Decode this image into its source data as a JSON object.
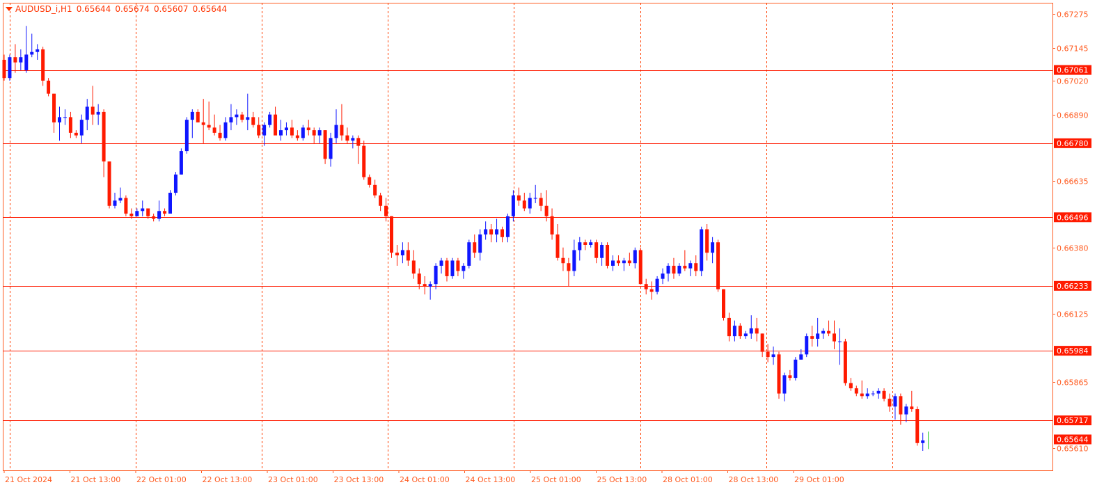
{
  "header": {
    "symbol": "AUDUSD_i,H1",
    "open": "0.65644",
    "high": "0.65674",
    "low": "0.65607",
    "close": "0.65644"
  },
  "colors": {
    "bull": "#0f16ff",
    "bear": "#ff1a00",
    "axis": "#ff5a1f",
    "level_line": "#ff1a00",
    "label_bg": "#ff1a00",
    "grid": "#ff3d00",
    "current": "#22c822"
  },
  "chart_data": {
    "type": "candlestick",
    "timeframe": "H1",
    "y_range": [
      0.6556,
      0.673
    ],
    "y_ticks": [
      "0.67275",
      "0.67145",
      "0.67020",
      "0.66890",
      "0.66635",
      "0.66380",
      "0.66125",
      "0.65865",
      "0.65610"
    ],
    "x_labels": [
      "21 Oct 2024",
      "21 Oct 13:00",
      "22 Oct 01:00",
      "22 Oct 13:00",
      "23 Oct 01:00",
      "23 Oct 13:00",
      "24 Oct 01:00",
      "24 Oct 13:00",
      "25 Oct 01:00",
      "25 Oct 13:00",
      "28 Oct 01:00",
      "28 Oct 13:00",
      "29 Oct 01:00"
    ],
    "day_separators": [
      1,
      25,
      49,
      73,
      97,
      121,
      145,
      169
    ],
    "horizontal_levels": [
      "0.67061",
      "0.66780",
      "0.66496",
      "0.66233",
      "0.65984",
      "0.65717"
    ],
    "current_price": "0.65644",
    "candles": [
      [
        0.671,
        0.6712,
        0.6702,
        0.6703
      ],
      [
        0.6703,
        0.6712,
        0.6702,
        0.6711
      ],
      [
        0.6711,
        0.6716,
        0.6705,
        0.6709
      ],
      [
        0.6709,
        0.6714,
        0.6706,
        0.6711
      ],
      [
        0.6706,
        0.6723,
        0.6705,
        0.6712
      ],
      [
        0.6712,
        0.672,
        0.6711,
        0.6713
      ],
      [
        0.6713,
        0.6716,
        0.671,
        0.6714
      ],
      [
        0.6714,
        0.6715,
        0.67,
        0.6702
      ],
      [
        0.6702,
        0.6703,
        0.6696,
        0.6697
      ],
      [
        0.6697,
        0.6697,
        0.6682,
        0.6686
      ],
      [
        0.6686,
        0.6692,
        0.6679,
        0.6688
      ],
      [
        0.6688,
        0.6691,
        0.6685,
        0.6688
      ],
      [
        0.6688,
        0.669,
        0.668,
        0.6682
      ],
      [
        0.6682,
        0.6683,
        0.668,
        0.6681
      ],
      [
        0.6681,
        0.6689,
        0.6678,
        0.6687
      ],
      [
        0.6687,
        0.6695,
        0.6683,
        0.6692
      ],
      [
        0.6692,
        0.67,
        0.6685,
        0.6689
      ],
      [
        0.6689,
        0.6693,
        0.6685,
        0.669
      ],
      [
        0.669,
        0.6691,
        0.6665,
        0.6671
      ],
      [
        0.6671,
        0.6671,
        0.6653,
        0.6654
      ],
      [
        0.6654,
        0.6659,
        0.6653,
        0.6656
      ],
      [
        0.6656,
        0.6661,
        0.6655,
        0.6657
      ],
      [
        0.6657,
        0.6658,
        0.665,
        0.6651
      ],
      [
        0.6651,
        0.6653,
        0.6649,
        0.665
      ],
      [
        0.665,
        0.6653,
        0.665,
        0.6652
      ],
      [
        0.6652,
        0.6656,
        0.665,
        0.6653
      ],
      [
        0.6653,
        0.6653,
        0.6649,
        0.665
      ],
      [
        0.665,
        0.6651,
        0.6648,
        0.6649
      ],
      [
        0.6649,
        0.6656,
        0.6648,
        0.6652
      ],
      [
        0.6652,
        0.6653,
        0.665,
        0.6651
      ],
      [
        0.6651,
        0.666,
        0.6651,
        0.6659
      ],
      [
        0.6659,
        0.6667,
        0.6658,
        0.6666
      ],
      [
        0.6666,
        0.6676,
        0.6666,
        0.6675
      ],
      [
        0.6675,
        0.6688,
        0.6674,
        0.6687
      ],
      [
        0.6687,
        0.6691,
        0.668,
        0.669
      ],
      [
        0.669,
        0.6691,
        0.6686,
        0.6686
      ],
      [
        0.6686,
        0.6695,
        0.6678,
        0.6685
      ],
      [
        0.6685,
        0.6694,
        0.6683,
        0.6684
      ],
      [
        0.6684,
        0.6689,
        0.6681,
        0.6682
      ],
      [
        0.6682,
        0.6685,
        0.6679,
        0.668
      ],
      [
        0.668,
        0.6688,
        0.6679,
        0.6686
      ],
      [
        0.6686,
        0.6693,
        0.6683,
        0.6688
      ],
      [
        0.6688,
        0.6691,
        0.6685,
        0.6689
      ],
      [
        0.6689,
        0.669,
        0.6686,
        0.6687
      ],
      [
        0.6687,
        0.6697,
        0.6683,
        0.6688
      ],
      [
        0.6688,
        0.669,
        0.6684,
        0.6685
      ],
      [
        0.6685,
        0.6688,
        0.668,
        0.6681
      ],
      [
        0.6681,
        0.6686,
        0.6677,
        0.6685
      ],
      [
        0.6685,
        0.669,
        0.6684,
        0.6689
      ],
      [
        0.6689,
        0.6692,
        0.6684,
        0.6681
      ],
      [
        0.6681,
        0.6687,
        0.6679,
        0.6683
      ],
      [
        0.6683,
        0.6686,
        0.6681,
        0.6684
      ],
      [
        0.6684,
        0.6687,
        0.668,
        0.6681
      ],
      [
        0.6681,
        0.6683,
        0.6679,
        0.668
      ],
      [
        0.668,
        0.6685,
        0.6679,
        0.6684
      ],
      [
        0.6684,
        0.6687,
        0.6681,
        0.6683
      ],
      [
        0.6683,
        0.6684,
        0.6678,
        0.6681
      ],
      [
        0.6681,
        0.6684,
        0.6678,
        0.6683
      ],
      [
        0.6683,
        0.6683,
        0.667,
        0.6672
      ],
      [
        0.6672,
        0.6682,
        0.6669,
        0.668
      ],
      [
        0.668,
        0.6691,
        0.6678,
        0.6685
      ],
      [
        0.6685,
        0.6693,
        0.6679,
        0.6681
      ],
      [
        0.6681,
        0.6684,
        0.6678,
        0.6679
      ],
      [
        0.6679,
        0.6681,
        0.6676,
        0.668
      ],
      [
        0.668,
        0.6681,
        0.667,
        0.6677
      ],
      [
        0.6677,
        0.6679,
        0.6664,
        0.6665
      ],
      [
        0.6665,
        0.6666,
        0.6661,
        0.6662
      ],
      [
        0.6662,
        0.6664,
        0.6657,
        0.6658
      ],
      [
        0.6658,
        0.6659,
        0.6652,
        0.6654
      ],
      [
        0.6654,
        0.6657,
        0.6648,
        0.665
      ],
      [
        0.665,
        0.665,
        0.6634,
        0.6636
      ],
      [
        0.6636,
        0.6639,
        0.6631,
        0.6635
      ],
      [
        0.6635,
        0.664,
        0.6632,
        0.6637
      ],
      [
        0.6637,
        0.664,
        0.6631,
        0.6633
      ],
      [
        0.6633,
        0.6637,
        0.6626,
        0.6628
      ],
      [
        0.6628,
        0.663,
        0.6622,
        0.6624
      ],
      [
        0.6624,
        0.6627,
        0.662,
        0.6623
      ],
      [
        0.6623,
        0.6625,
        0.6618,
        0.6624
      ],
      [
        0.6624,
        0.6632,
        0.6622,
        0.6631
      ],
      [
        0.6631,
        0.6634,
        0.6628,
        0.6633
      ],
      [
        0.6633,
        0.6634,
        0.6625,
        0.6627
      ],
      [
        0.6627,
        0.6634,
        0.6626,
        0.6633
      ],
      [
        0.6633,
        0.6634,
        0.6627,
        0.6629
      ],
      [
        0.6629,
        0.6632,
        0.6626,
        0.6631
      ],
      [
        0.6631,
        0.6641,
        0.663,
        0.664
      ],
      [
        0.664,
        0.6643,
        0.6634,
        0.6636
      ],
      [
        0.6636,
        0.6645,
        0.6633,
        0.6643
      ],
      [
        0.6643,
        0.6648,
        0.6641,
        0.6645
      ],
      [
        0.6645,
        0.6647,
        0.664,
        0.6643
      ],
      [
        0.6643,
        0.6649,
        0.664,
        0.6645
      ],
      [
        0.6645,
        0.6646,
        0.664,
        0.6642
      ],
      [
        0.6642,
        0.6651,
        0.664,
        0.665
      ],
      [
        0.665,
        0.666,
        0.6648,
        0.6658
      ],
      [
        0.6658,
        0.6661,
        0.6654,
        0.6656
      ],
      [
        0.6656,
        0.6659,
        0.6652,
        0.6653
      ],
      [
        0.6653,
        0.6659,
        0.6651,
        0.6657
      ],
      [
        0.6657,
        0.6662,
        0.6655,
        0.6657
      ],
      [
        0.6657,
        0.6659,
        0.6652,
        0.6654
      ],
      [
        0.6654,
        0.666,
        0.6648,
        0.665
      ],
      [
        0.665,
        0.6653,
        0.6641,
        0.6643
      ],
      [
        0.6643,
        0.6647,
        0.6633,
        0.6634
      ],
      [
        0.6634,
        0.6638,
        0.6629,
        0.6632
      ],
      [
        0.6632,
        0.6634,
        0.6623,
        0.6629
      ],
      [
        0.6629,
        0.6641,
        0.6627,
        0.6637
      ],
      [
        0.6637,
        0.6642,
        0.6633,
        0.664
      ],
      [
        0.664,
        0.6641,
        0.6637,
        0.6639
      ],
      [
        0.6639,
        0.6641,
        0.6638,
        0.664
      ],
      [
        0.664,
        0.6641,
        0.6632,
        0.6634
      ],
      [
        0.6634,
        0.664,
        0.6631,
        0.6639
      ],
      [
        0.6639,
        0.664,
        0.663,
        0.6631
      ],
      [
        0.6631,
        0.6635,
        0.6629,
        0.6633
      ],
      [
        0.6633,
        0.6635,
        0.6631,
        0.6632
      ],
      [
        0.6632,
        0.6634,
        0.6629,
        0.6633
      ],
      [
        0.6633,
        0.6636,
        0.6631,
        0.6632
      ],
      [
        0.6632,
        0.6638,
        0.663,
        0.6637
      ],
      [
        0.6637,
        0.6638,
        0.6624,
        0.6624
      ],
      [
        0.6624,
        0.6626,
        0.662,
        0.6622
      ],
      [
        0.6622,
        0.6625,
        0.6618,
        0.6621
      ],
      [
        0.6621,
        0.6627,
        0.662,
        0.6626
      ],
      [
        0.6626,
        0.663,
        0.6624,
        0.6628
      ],
      [
        0.6628,
        0.6632,
        0.6625,
        0.6631
      ],
      [
        0.6631,
        0.6634,
        0.6626,
        0.6628
      ],
      [
        0.6628,
        0.6632,
        0.6627,
        0.6631
      ],
      [
        0.6631,
        0.6637,
        0.6629,
        0.663
      ],
      [
        0.663,
        0.6633,
        0.6627,
        0.6632
      ],
      [
        0.6632,
        0.6635,
        0.6627,
        0.6629
      ],
      [
        0.6629,
        0.6646,
        0.6627,
        0.6645
      ],
      [
        0.6645,
        0.6647,
        0.6633,
        0.6636
      ],
      [
        0.6636,
        0.6642,
        0.6632,
        0.664
      ],
      [
        0.664,
        0.6641,
        0.6621,
        0.6622
      ],
      [
        0.6622,
        0.6622,
        0.661,
        0.6611
      ],
      [
        0.6611,
        0.6613,
        0.6602,
        0.6604
      ],
      [
        0.6604,
        0.661,
        0.6602,
        0.6608
      ],
      [
        0.6608,
        0.6609,
        0.6603,
        0.6604
      ],
      [
        0.6604,
        0.6606,
        0.6603,
        0.6605
      ],
      [
        0.6605,
        0.6612,
        0.6603,
        0.6607
      ],
      [
        0.6607,
        0.6611,
        0.6602,
        0.6605
      ],
      [
        0.6605,
        0.6605,
        0.6596,
        0.6598
      ],
      [
        0.6598,
        0.6601,
        0.6594,
        0.6596
      ],
      [
        0.6596,
        0.66,
        0.6593,
        0.6597
      ],
      [
        0.6597,
        0.6598,
        0.658,
        0.6582
      ],
      [
        0.6582,
        0.659,
        0.6579,
        0.6589
      ],
      [
        0.6589,
        0.6591,
        0.6587,
        0.6588
      ],
      [
        0.6588,
        0.6596,
        0.6587,
        0.6595
      ],
      [
        0.6595,
        0.6599,
        0.6595,
        0.6597
      ],
      [
        0.6597,
        0.6605,
        0.6596,
        0.6604
      ],
      [
        0.6604,
        0.6608,
        0.66,
        0.6603
      ],
      [
        0.6603,
        0.6611,
        0.66,
        0.6605
      ],
      [
        0.6605,
        0.6607,
        0.6603,
        0.6606
      ],
      [
        0.6606,
        0.661,
        0.6604,
        0.6605
      ],
      [
        0.6605,
        0.661,
        0.6599,
        0.6602
      ],
      [
        0.6602,
        0.6607,
        0.6593,
        0.6602
      ],
      [
        0.6602,
        0.6603,
        0.6585,
        0.6586
      ],
      [
        0.6586,
        0.6588,
        0.6583,
        0.6584
      ],
      [
        0.6584,
        0.6585,
        0.6581,
        0.6582
      ],
      [
        0.6582,
        0.6587,
        0.658,
        0.6581
      ],
      [
        0.6581,
        0.6584,
        0.658,
        0.6582
      ],
      [
        0.6582,
        0.6583,
        0.6581,
        0.6582
      ],
      [
        0.6582,
        0.6584,
        0.658,
        0.6583
      ],
      [
        0.6583,
        0.6584,
        0.6579,
        0.658
      ],
      [
        0.658,
        0.6582,
        0.6575,
        0.6577
      ],
      [
        0.6577,
        0.6582,
        0.6572,
        0.6581
      ],
      [
        0.6581,
        0.6582,
        0.657,
        0.6574
      ],
      [
        0.6574,
        0.6578,
        0.6571,
        0.6577
      ],
      [
        0.6577,
        0.6583,
        0.6575,
        0.6576
      ],
      [
        0.6576,
        0.6577,
        0.6562,
        0.6563
      ],
      [
        0.6563,
        0.6567,
        0.656,
        0.6564
      ]
    ]
  }
}
